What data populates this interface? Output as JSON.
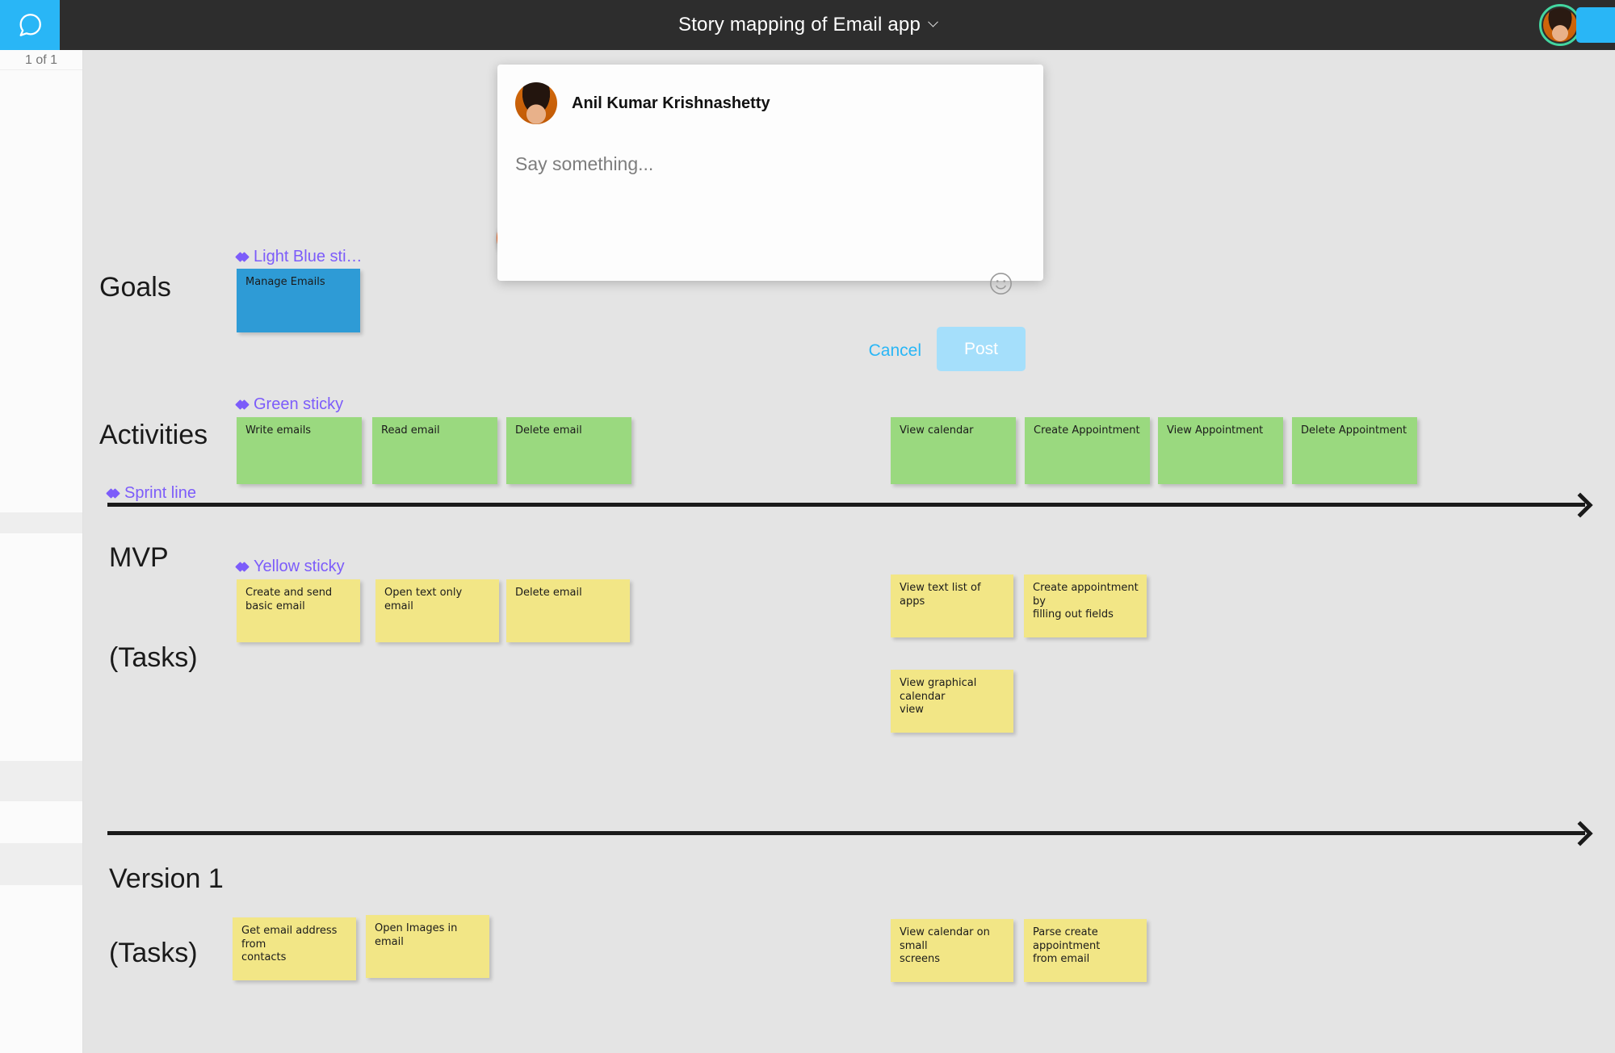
{
  "header": {
    "chat_icon": "speech-bubble-icon",
    "title": "Story mapping of Email app",
    "title_caret": "chevron-down-icon",
    "avatar_icon": "user-avatar",
    "invite_label": ""
  },
  "left_panel": {
    "page_indicator": "1 of 1"
  },
  "dialog": {
    "author": "Anil Kumar Krishnashetty",
    "avatar_icon": "author-avatar",
    "input_value": "",
    "input_placeholder": "Say something...",
    "emoji_icon": "smiley-face-icon",
    "cancel_label": "Cancel",
    "post_label": "Post"
  },
  "board": {
    "pin_marker": "map-pin-marker",
    "rows": [
      {
        "label": "Goals"
      },
      {
        "label": "Activities"
      },
      {
        "label": "MVP"
      },
      {
        "label": "(Tasks)"
      },
      {
        "label": "Version 1"
      },
      {
        "label": "(Tasks)"
      }
    ],
    "type_labels": {
      "light_blue": "Light Blue sti…",
      "green": "Green sticky",
      "sprint": "Sprint line",
      "yellow": "Yellow sticky"
    },
    "goals": [
      {
        "text": "Manage Emails",
        "color": "#2e9bd6"
      }
    ],
    "activities_left": [
      {
        "text": "Write emails",
        "color": "#9ad97f"
      },
      {
        "text": "Read email",
        "color": "#9ad97f"
      },
      {
        "text": "Delete email",
        "color": "#9ad97f"
      }
    ],
    "activities_right": [
      {
        "text": "View calendar",
        "color": "#9ad97f"
      },
      {
        "text": "Create Appointment",
        "color": "#9ad97f"
      },
      {
        "text": "View Appointment",
        "color": "#9ad97f"
      },
      {
        "text": "Delete Appointment",
        "color": "#9ad97f"
      }
    ],
    "mvp_left": [
      {
        "text": "Create and send basic email",
        "color": "#f2e686"
      },
      {
        "text": "Open text only email",
        "color": "#f2e686"
      },
      {
        "text": "Delete email",
        "color": "#f2e686"
      }
    ],
    "mvp_right": [
      {
        "text": "View text list of apps",
        "color": "#f2e686"
      },
      {
        "text": "Create appointment by\nfilling out fields",
        "color": "#f2e686"
      },
      {
        "text": "View graphical calendar\nview",
        "color": "#f2e686"
      }
    ],
    "version1_left": [
      {
        "text": "Get email address from\ncontacts",
        "color": "#f2e686"
      },
      {
        "text": "Open Images in email",
        "color": "#f2e686"
      }
    ],
    "version1_right": [
      {
        "text": "View calendar on small\nscreens",
        "color": "#f2e686"
      },
      {
        "text": "Parse create appointment\nfrom email",
        "color": "#f2e686"
      }
    ]
  },
  "colors": {
    "accent": "#29b6f6",
    "canvas_bg": "#e4e4e4",
    "topbar_bg": "#2d2d2d",
    "sticky_label": "#7c5cfa",
    "pin": "#f96c27",
    "avatar_ring": "#43d6a0"
  }
}
